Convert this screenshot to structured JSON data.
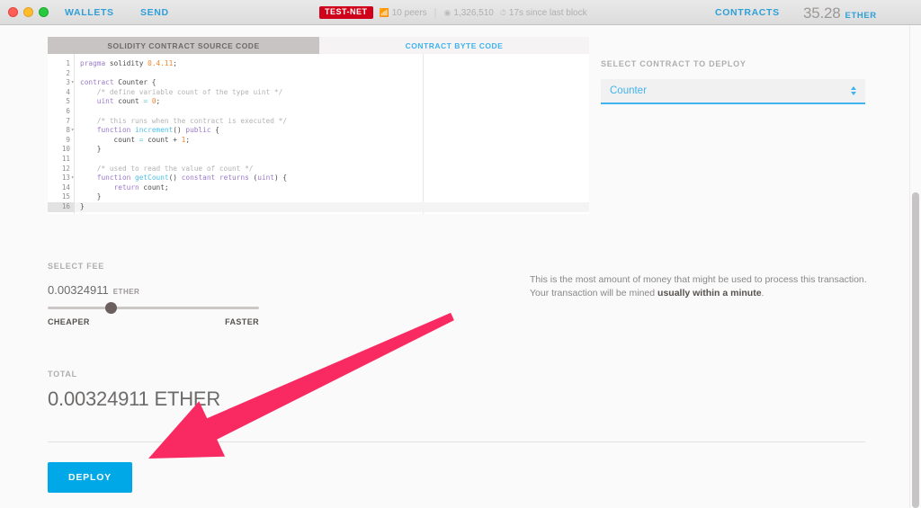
{
  "window": {
    "traffic_lights": [
      "close",
      "minimize",
      "maximize"
    ]
  },
  "nav": {
    "wallets": "WALLETS",
    "send": "SEND",
    "contracts": "CONTRACTS"
  },
  "status": {
    "network_badge": "TEST-NET",
    "peers": "10 peers",
    "block_number": "1,326,510",
    "last_block": "17s since last block",
    "separator": "|"
  },
  "balance": {
    "amount": "35.28",
    "unit": "ETHER"
  },
  "tabs": {
    "source": "SOLIDITY CONTRACT SOURCE CODE",
    "bytecode": "CONTRACT BYTE CODE"
  },
  "editor": {
    "active_line": 16,
    "fold_lines": [
      3,
      8,
      13
    ],
    "lines": [
      {
        "n": "1",
        "text": "pragma solidity ^0.4.11;"
      },
      {
        "n": "2",
        "text": ""
      },
      {
        "n": "3",
        "text": "contract Counter {"
      },
      {
        "n": "4",
        "text": "    /* define variable count of the type uint */"
      },
      {
        "n": "5",
        "text": "    uint count = 0;"
      },
      {
        "n": "6",
        "text": ""
      },
      {
        "n": "7",
        "text": "    /* this runs when the contract is executed */"
      },
      {
        "n": "8",
        "text": "    function increment() public {"
      },
      {
        "n": "9",
        "text": "        count = count + 1;"
      },
      {
        "n": "10",
        "text": "    }"
      },
      {
        "n": "11",
        "text": ""
      },
      {
        "n": "12",
        "text": "    /* used to read the value of count */"
      },
      {
        "n": "13",
        "text": "    function getCount() constant returns (uint) {"
      },
      {
        "n": "14",
        "text": "        return count;"
      },
      {
        "n": "15",
        "text": "    }"
      },
      {
        "n": "16",
        "text": "}"
      }
    ]
  },
  "deploy_panel": {
    "select_label": "SELECT CONTRACT TO DEPLOY",
    "selected_contract": "Counter",
    "options": [
      "Counter"
    ]
  },
  "fee": {
    "label": "SELECT FEE",
    "amount": "0.00324911",
    "unit": "ETHER",
    "slider_percent": 30,
    "cheaper": "CHEAPER",
    "faster": "FASTER",
    "note_prefix": "This is the most amount of money that might be used to process this transaction. Your transaction will be mined ",
    "note_bold": "usually within a minute",
    "note_suffix": "."
  },
  "total": {
    "label": "TOTAL",
    "value": "0.00324911 ETHER"
  },
  "actions": {
    "deploy": "DEPLOY"
  },
  "colors": {
    "accent_blue": "#3fb3ef",
    "deploy_blue": "#00a8e8",
    "testnet_red": "#d0021b",
    "annotation_pink": "#f92a61",
    "text_gray": "#6d6a6a"
  },
  "annotation": {
    "type": "arrow",
    "color": "#f92a61",
    "from": [
      503,
      352
    ],
    "to": [
      165,
      510
    ],
    "points_at": "deploy-button"
  }
}
